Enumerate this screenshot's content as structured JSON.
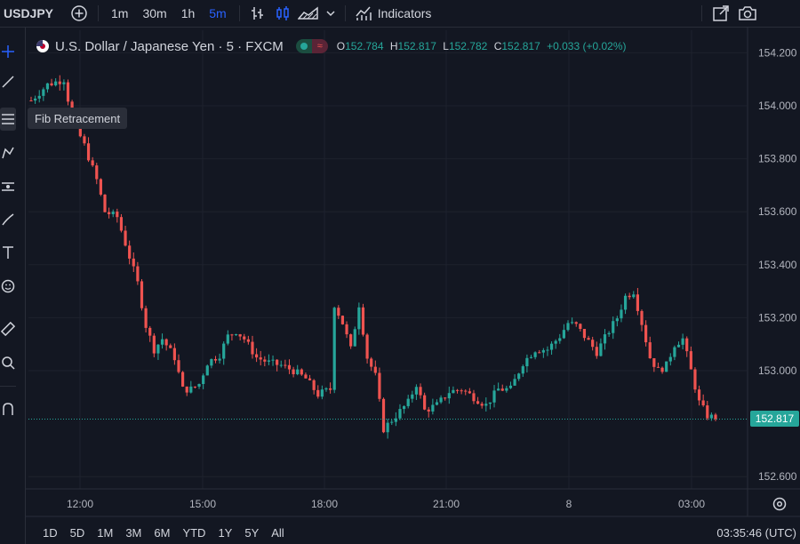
{
  "topbar": {
    "symbol": "USDJPY",
    "timeframes": [
      "1m",
      "30m",
      "1h",
      "5m"
    ],
    "active_timeframe": "5m",
    "indicators_label": "Indicators"
  },
  "legend": {
    "title": "U.S. Dollar / Japanese Yen · 5 · FXCM",
    "open_label": "O",
    "open": "152.784",
    "high_label": "H",
    "high": "152.817",
    "low_label": "L",
    "low": "152.782",
    "close_label": "C",
    "close": "152.817",
    "change": "+0.033 (+0.02%)"
  },
  "tooltip": "Fib Retracement",
  "price_tag": "152.817",
  "bottombar": {
    "ranges": [
      "1D",
      "5D",
      "1M",
      "3M",
      "6M",
      "YTD",
      "1Y",
      "5Y",
      "All"
    ],
    "clock": "03:35:46 (UTC)"
  },
  "colors": {
    "up": "#26a69a",
    "down": "#ef5350",
    "background": "#131722",
    "grid": "#1e222d",
    "accent": "#2962ff"
  },
  "chart_data": {
    "type": "candlestick",
    "title": "U.S. Dollar / Japanese Yen · 5 · FXCM",
    "xlabel": "",
    "ylabel": "",
    "ylim": [
      152.52,
      154.26
    ],
    "y_ticks": [
      "154.200",
      "154.000",
      "153.800",
      "153.600",
      "153.400",
      "153.200",
      "153.000",
      "152.600"
    ],
    "x_tick_labels": [
      "12:00",
      "15:00",
      "18:00",
      "21:00",
      "8",
      "03:00"
    ],
    "grid": true,
    "last_price": 152.817,
    "path": [
      [
        0,
        154.02
      ],
      [
        4,
        154.08
      ],
      [
        8,
        154.1
      ],
      [
        10,
        153.95
      ],
      [
        13,
        153.85
      ],
      [
        16,
        153.72
      ],
      [
        18,
        153.6
      ],
      [
        21,
        153.58
      ],
      [
        24,
        153.43
      ],
      [
        26,
        153.33
      ],
      [
        28,
        153.17
      ],
      [
        30,
        153.08
      ],
      [
        32,
        153.12
      ],
      [
        35,
        153.05
      ],
      [
        37,
        152.93
      ],
      [
        39,
        152.93
      ],
      [
        41,
        152.95
      ],
      [
        43,
        153.03
      ],
      [
        46,
        153.06
      ],
      [
        48,
        153.13
      ],
      [
        50,
        153.15
      ],
      [
        52,
        153.12
      ],
      [
        55,
        153.05
      ],
      [
        58,
        153.03
      ],
      [
        61,
        153.02
      ],
      [
        64,
        153.0
      ],
      [
        67,
        152.97
      ],
      [
        70,
        152.91
      ],
      [
        73,
        152.93
      ],
      [
        74,
        153.25
      ],
      [
        76,
        153.18
      ],
      [
        78,
        153.08
      ],
      [
        80,
        153.25
      ],
      [
        82,
        153.05
      ],
      [
        84,
        152.98
      ],
      [
        86,
        152.78
      ],
      [
        89,
        152.83
      ],
      [
        92,
        152.88
      ],
      [
        94,
        152.95
      ],
      [
        96,
        152.85
      ],
      [
        99,
        152.87
      ],
      [
        102,
        152.92
      ],
      [
        105,
        152.93
      ],
      [
        108,
        152.9
      ],
      [
        111,
        152.87
      ],
      [
        114,
        152.93
      ],
      [
        117,
        152.93
      ],
      [
        120,
        153.03
      ],
      [
        123,
        153.08
      ],
      [
        126,
        153.08
      ],
      [
        129,
        153.13
      ],
      [
        131,
        153.18
      ],
      [
        133,
        153.17
      ],
      [
        135,
        153.13
      ],
      [
        138,
        153.07
      ],
      [
        141,
        153.15
      ],
      [
        143,
        153.2
      ],
      [
        145,
        153.28
      ],
      [
        147,
        153.3
      ],
      [
        149,
        153.18
      ],
      [
        151,
        153.05
      ],
      [
        153,
        153.0
      ],
      [
        155,
        153.02
      ],
      [
        157,
        153.1
      ],
      [
        159,
        153.12
      ],
      [
        161,
        153.0
      ],
      [
        163,
        152.88
      ],
      [
        165,
        152.83
      ],
      [
        167,
        152.82
      ]
    ]
  }
}
